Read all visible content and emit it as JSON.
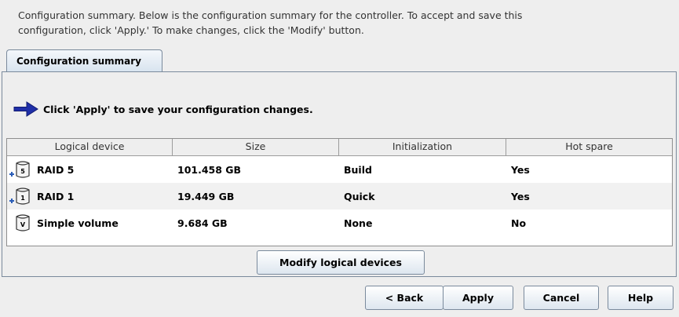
{
  "intro": {
    "line1": "Configuration summary. Below is the configuration summary for the controller.  To accept and save this",
    "line2": "configuration, click 'Apply.'  To make changes, click the 'Modify' button."
  },
  "tab": {
    "label": "Configuration summary"
  },
  "instruction": {
    "text": "Click 'Apply' to save your configuration changes."
  },
  "table": {
    "columns": [
      "Logical device",
      "Size",
      "Initialization",
      "Hot spare"
    ],
    "rows": [
      {
        "device": "RAID 5",
        "icon": "raid5-disk-icon",
        "badge": "5",
        "size": "101.458 GB",
        "initialization": "Build",
        "hot_spare": "Yes"
      },
      {
        "device": "RAID 1",
        "icon": "raid1-disk-icon",
        "badge": "1",
        "size": "19.449 GB",
        "initialization": "Quick",
        "hot_spare": "Yes"
      },
      {
        "device": "Simple volume",
        "icon": "simple-volume-disk-icon",
        "badge": "V",
        "size": "9.684 GB",
        "initialization": "None",
        "hot_spare": "No"
      }
    ]
  },
  "buttons": {
    "modify": "Modify logical devices",
    "back": "< Back",
    "apply": "Apply",
    "cancel": "Cancel",
    "help": "Help"
  },
  "colors": {
    "arrow": "#1f2fa8",
    "tab_bg": "#dbe6f1",
    "border": "#7a8a9c"
  }
}
